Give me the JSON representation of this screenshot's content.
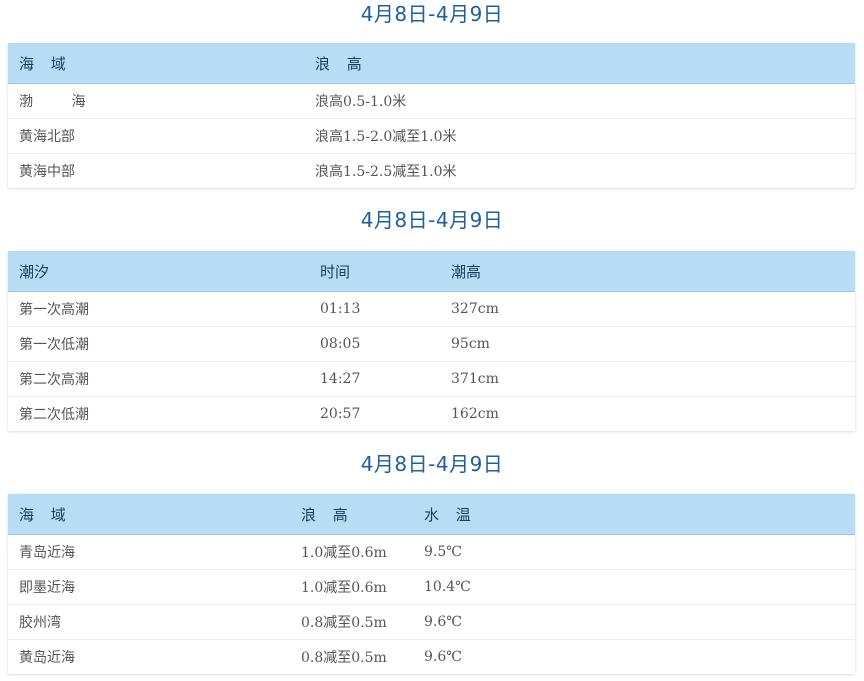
{
  "wave_forecast": {
    "date_range": "4月8日-4月9日",
    "headers": {
      "sea_area": "海 域",
      "wave_height": "浪 高"
    },
    "rows": [
      {
        "area": "渤 海",
        "wave": "浪高0.5-1.0米"
      },
      {
        "area": "黄海北部",
        "wave": "浪高1.5-2.0减至1.0米"
      },
      {
        "area": "黄海中部",
        "wave": "浪高1.5-2.5减至1.0米"
      }
    ]
  },
  "tide_forecast": {
    "date_range": "4月8日-4月9日",
    "headers": {
      "tide": "潮汐",
      "time": "时间",
      "tide_height": "潮高"
    },
    "rows": [
      {
        "name": "第一次高潮",
        "time": "01:13",
        "height": "327cm"
      },
      {
        "name": "第一次低潮",
        "time": "08:05",
        "height": "95cm"
      },
      {
        "name": "第二次高潮",
        "time": "14:27",
        "height": "371cm"
      },
      {
        "name": "第二次低潮",
        "time": "20:57",
        "height": "162cm"
      }
    ]
  },
  "coastal_forecast": {
    "date_range": "4月8日-4月9日",
    "headers": {
      "sea_area": "海 域",
      "wave_height": "浪 高",
      "water_temp": "水 温"
    },
    "rows": [
      {
        "area": "青岛近海",
        "wave": "1.0减至0.6m",
        "temp": "9.5℃"
      },
      {
        "area": "即墨近海",
        "wave": "1.0减至0.6m",
        "temp": "10.4℃"
      },
      {
        "area": "胶州湾",
        "wave": "0.8减至0.5m",
        "temp": "9.6℃"
      },
      {
        "area": "黄岛近海",
        "wave": "0.8减至0.5m",
        "temp": "9.6℃"
      }
    ]
  }
}
